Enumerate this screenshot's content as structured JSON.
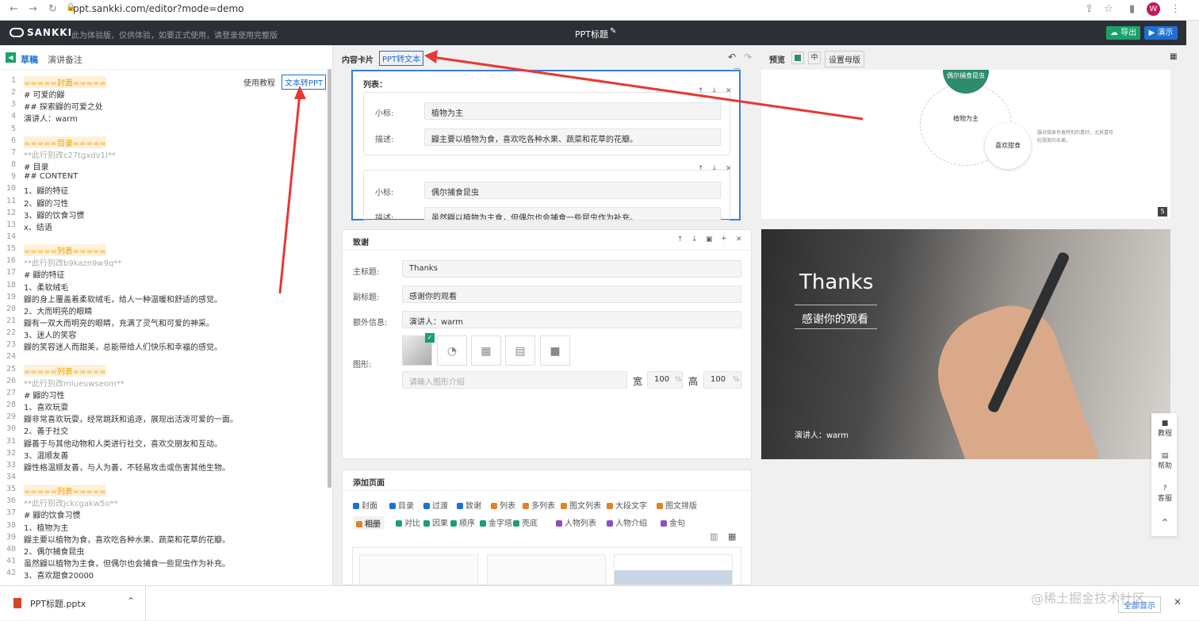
{
  "browser": {
    "url": "ppt.sankki.com/editor?mode=demo",
    "avatar": "W"
  },
  "app": {
    "logo": "SANKKI",
    "notice": "此为体验版，仅供体验，如要正式使用，请登录使用完整版",
    "title": "PPT标题",
    "export_label": "导出",
    "present_label": "演示"
  },
  "left": {
    "tabs": [
      "草稿",
      "演讲备注"
    ],
    "help_label": "使用教程",
    "convert_label": "文本转PPT",
    "lines": [
      {
        "n": "1",
        "t": "=====封面=====",
        "c": "hl"
      },
      {
        "n": "2",
        "t": "# 可爱的鼹",
        "c": ""
      },
      {
        "n": "3",
        "t": "## 探索鼹的可爱之处",
        "c": ""
      },
      {
        "n": "4",
        "t": "演讲人：warm",
        "c": ""
      },
      {
        "n": "5",
        "t": "",
        "c": ""
      },
      {
        "n": "6",
        "t": "=====目录=====",
        "c": "hl"
      },
      {
        "n": "7",
        "t": "**此行别改c27tgxdv1l**",
        "c": "gray"
      },
      {
        "n": "8",
        "t": "# 目录",
        "c": ""
      },
      {
        "n": "9",
        "t": "## CONTENT",
        "c": ""
      },
      {
        "n": "10",
        "t": "1、鼹的特征",
        "c": ""
      },
      {
        "n": "11",
        "t": "2、鼹的习性",
        "c": ""
      },
      {
        "n": "12",
        "t": "3、鼹的饮食习惯",
        "c": ""
      },
      {
        "n": "13",
        "t": "x、结语",
        "c": ""
      },
      {
        "n": "14",
        "t": "",
        "c": ""
      },
      {
        "n": "15",
        "t": "=====列表=====",
        "c": "hl"
      },
      {
        "n": "16",
        "t": "**此行别改b9kazn9w9q**",
        "c": "gray"
      },
      {
        "n": "17",
        "t": "# 鼹的特征",
        "c": ""
      },
      {
        "n": "18",
        "t": "1、柔软绒毛",
        "c": ""
      },
      {
        "n": "19",
        "t": "鼹的身上覆盖着柔软绒毛，给人一种温暖和舒适的感觉。",
        "c": ""
      },
      {
        "n": "20",
        "t": "2、大而明亮的眼睛",
        "c": ""
      },
      {
        "n": "21",
        "t": "鼹有一双大而明亮的眼睛，充满了灵气和可爱的神采。",
        "c": ""
      },
      {
        "n": "22",
        "t": "3、迷人的笑容",
        "c": ""
      },
      {
        "n": "23",
        "t": "鼹的笑容迷人而甜美，总能带给人们快乐和幸福的感觉。",
        "c": ""
      },
      {
        "n": "24",
        "t": "",
        "c": ""
      },
      {
        "n": "25",
        "t": "=====列表=====",
        "c": "hl"
      },
      {
        "n": "26",
        "t": "**此行别改mlueuwseom**",
        "c": "gray"
      },
      {
        "n": "27",
        "t": "# 鼹的习性",
        "c": ""
      },
      {
        "n": "28",
        "t": "1、喜欢玩耍",
        "c": ""
      },
      {
        "n": "29",
        "t": "鼹非常喜欢玩耍，经常跳跃和追逐，展现出活泼可爱的一面。",
        "c": ""
      },
      {
        "n": "30",
        "t": "2、善于社交",
        "c": ""
      },
      {
        "n": "31",
        "t": "鼹善于与其他动物和人类进行社交，喜欢交朋友和互动。",
        "c": ""
      },
      {
        "n": "32",
        "t": "3、温顺友善",
        "c": ""
      },
      {
        "n": "33",
        "t": "鼹性格温顺友善，与人为善，不轻易攻击或伤害其他生物。",
        "c": ""
      },
      {
        "n": "34",
        "t": "",
        "c": ""
      },
      {
        "n": "35",
        "t": "=====列表=====",
        "c": "hl"
      },
      {
        "n": "36",
        "t": "**此行别改jckcgakw5o**",
        "c": "gray"
      },
      {
        "n": "37",
        "t": "# 鼹的饮食习惯",
        "c": ""
      },
      {
        "n": "38",
        "t": "1、植物为主",
        "c": ""
      },
      {
        "n": "39",
        "t": "鼹主要以植物为食，喜欢吃各种水果、蔬菜和花草的花瓣。",
        "c": ""
      },
      {
        "n": "40",
        "t": "2、偶尔捕食昆虫",
        "c": ""
      },
      {
        "n": "41",
        "t": "虽然鼹以植物为主食，但偶尔也会捕食一些昆虫作为补充。",
        "c": ""
      },
      {
        "n": "42",
        "t": "3、喜欢甜食20000",
        "c": ""
      }
    ]
  },
  "middle": {
    "header_title": "内容卡片",
    "header_tab": "PPT转文本",
    "list_card": {
      "title": "列表：",
      "items": [
        {
          "sub_label": "小标:",
          "sub": "植物为主",
          "desc_label": "描述:",
          "desc": "鼹主要以植物为食，喜欢吃各种水果、蔬菜和花草的花瓣。"
        },
        {
          "sub_label": "小标:",
          "sub": "偶尔捕食昆虫",
          "desc_label": "描述:",
          "desc": "虽然鼹以植物为主食，但偶尔也会捕食一些昆虫作为补充。"
        }
      ]
    },
    "thanks_card": {
      "title": "致谢",
      "main_label": "主标题:",
      "main": "Thanks",
      "sub_label": "副标题:",
      "sub": "感谢你的观看",
      "extra_label": "额外信息:",
      "extra": "演讲人：warm",
      "shape_label": "图形:",
      "shape_placeholder": "请输入图形介绍",
      "w_label": "宽",
      "w": "100",
      "h_label": "高",
      "h": "100",
      "pct": "%"
    },
    "add_card": {
      "title": "添加页面",
      "chips": [
        {
          "t": "封面",
          "c": "#1d6fd6"
        },
        {
          "t": "目录",
          "c": "#1d6fd6"
        },
        {
          "t": "过渡",
          "c": "#1d6fd6"
        },
        {
          "t": "致谢",
          "c": "#1d6fd6"
        },
        {
          "t": "列表",
          "c": "#e0832a"
        },
        {
          "t": "多列表",
          "c": "#e0832a"
        },
        {
          "t": "图文列表",
          "c": "#e0832a"
        },
        {
          "t": "大段文字",
          "c": "#e0832a"
        },
        {
          "t": "图文排版",
          "c": "#e0832a"
        },
        {
          "t": "相册",
          "c": "#e0832a"
        },
        {
          "t": "对比",
          "c": "#1aa16a"
        },
        {
          "t": "因果",
          "c": "#1aa16a"
        },
        {
          "t": "顺序",
          "c": "#1aa16a"
        },
        {
          "t": "金字塔",
          "c": "#1aa16a"
        },
        {
          "t": "壳底",
          "c": "#1aa16a"
        },
        {
          "t": "人物列表",
          "c": "#8a4fc9"
        },
        {
          "t": "人物介绍",
          "c": "#8a4fc9"
        },
        {
          "t": "金句",
          "c": "#8a4fc9"
        }
      ]
    }
  },
  "right": {
    "preview_label": "预览",
    "size_label": "中",
    "master_label": "设置母版",
    "slide5": {
      "center": "植物为主",
      "bubble": "喜欢甜食",
      "top": "偶尔捕食昆虫",
      "desc": "鼹对甜食有着特别的喜好，尤其喜欢吃甜美的水果。",
      "page": "5"
    },
    "thanks": {
      "title": "Thanks",
      "subtitle": "感谢你的观看",
      "speaker": "演讲人：warm"
    }
  },
  "side": {
    "tutorial": "教程",
    "help": "帮助",
    "feedback": "客服"
  },
  "download": {
    "file": "PPT标题.pptx",
    "show_all": "全部显示"
  },
  "watermark": "@稀土掘金技术社区"
}
